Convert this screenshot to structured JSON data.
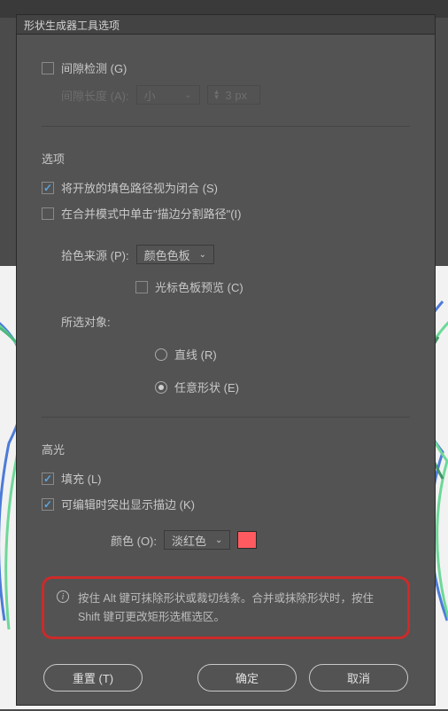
{
  "dialog": {
    "title": "形状生成器工具选项"
  },
  "gap": {
    "detect_label": "间隙检测 (G)",
    "length_label": "间隙长度 (A):",
    "size_option": "小",
    "px_value": "3 px"
  },
  "options": {
    "section": "选项",
    "open_fill_label": "将开放的填色路径视为闭合 (S)",
    "merge_mode_label": "在合并模式中单击\"描边分割路径\"(I)",
    "pick_source_label": "拾色来源 (P):",
    "pick_source_value": "颜色色板",
    "cursor_preview_label": "光标色板预览 (C)",
    "selected_label": "所选对象:",
    "radio_line": "直线 (R)",
    "radio_any": "任意形状 (E)"
  },
  "highlight": {
    "section": "高光",
    "fill_label": "填充 (L)",
    "stroke_label": "可编辑时突出显示描边 (K)",
    "color_label": "颜色 (O):",
    "color_value": "淡红色",
    "swatch_hex": "#ff5a5f"
  },
  "info": {
    "text": "按住 Alt 键可抹除形状或裁切线条。合并或抹除形状时，按住 Shift 键可更改矩形选框选区。"
  },
  "footer": {
    "reset": "重置 (T)",
    "ok": "确定",
    "cancel": "取消"
  }
}
